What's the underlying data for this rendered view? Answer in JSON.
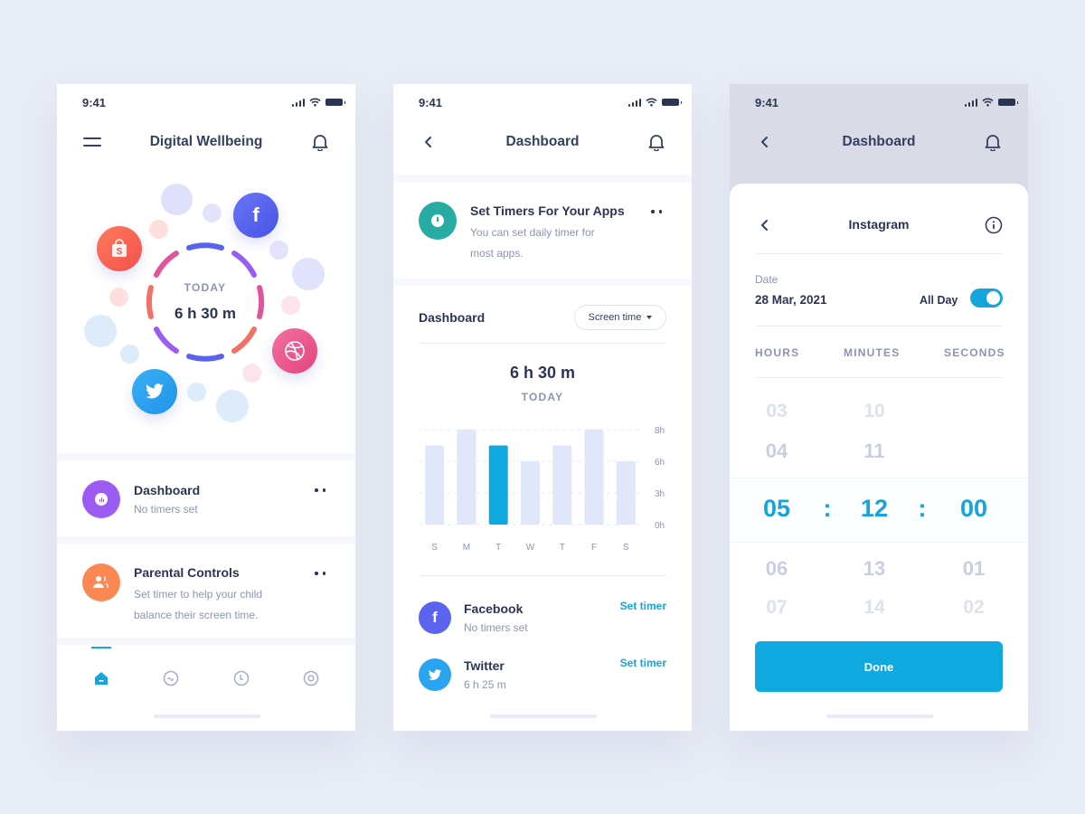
{
  "status_bar": {
    "time": "9:41"
  },
  "screen1": {
    "title": "Digital Wellbeing",
    "ring": {
      "label": "TODAY",
      "value": "6 h 30 m"
    },
    "apps_icons": [
      "shopee-bag-icon",
      "facebook-icon",
      "dribbble-icon",
      "twitter-icon"
    ],
    "cards": [
      {
        "title": "Dashboard",
        "subtitle": "No timers set",
        "icon": "chart-icon",
        "color": "#9c5cf3"
      },
      {
        "title": "Parental Controls",
        "subtitle_line1": "Set timer to help your child",
        "subtitle_line2": "balance their screen time.",
        "icon": "users-icon",
        "color": "#fb8852"
      }
    ],
    "tabs": [
      {
        "name": "home",
        "active": true
      },
      {
        "name": "activity",
        "active": false
      },
      {
        "name": "timer",
        "active": false
      },
      {
        "name": "settings",
        "active": false
      }
    ]
  },
  "screen2": {
    "title": "Dashboard",
    "promo": {
      "title": "Set Timers For Your Apps",
      "line1": "You can set daily timer for",
      "line2": "most apps."
    },
    "dashboard_label": "Dashboard",
    "dropdown": {
      "value": "Screen time"
    },
    "total": "6 h 30 m",
    "total_label": "TODAY",
    "apps": [
      {
        "name": "Facebook",
        "detail": "No timers set",
        "action": "Set timer",
        "color": "#5b63ef"
      },
      {
        "name": "Twitter",
        "detail": "6 h 25 m",
        "action": "Set timer",
        "color": "#2aa3f0"
      }
    ]
  },
  "chart_data": {
    "type": "bar",
    "title": "",
    "categories": [
      "S",
      "M",
      "T",
      "W",
      "T",
      "F",
      "S"
    ],
    "values": [
      7,
      8,
      7,
      6,
      7,
      8,
      6
    ],
    "highlight_index": 2,
    "yticks": [
      "0h",
      "3h",
      "6h",
      "8h"
    ],
    "ylim": [
      0,
      8
    ],
    "xlabel": "",
    "ylabel": "",
    "grid": true,
    "colors": {
      "bar": "#e1e7fb",
      "highlight": "#0fa8df"
    }
  },
  "screen3": {
    "title": "Dashboard",
    "sheet_title": "Instagram",
    "date_label": "Date",
    "date_value": "28 Mar, 2021",
    "all_day_label": "All Day",
    "all_day_on": true,
    "columns": [
      "HOURS",
      "MINUTES",
      "SECONDS"
    ],
    "hours": {
      "above2": "03",
      "above1": "04",
      "selected": "05",
      "below1": "06",
      "below2": "07"
    },
    "minutes": {
      "above2": "10",
      "above1": "11",
      "selected": "12",
      "below1": "13",
      "below2": "14"
    },
    "seconds": {
      "above2": "",
      "above1": "",
      "selected": "00",
      "below1": "01",
      "below2": "02"
    },
    "separator": ":",
    "done_label": "Done",
    "accent": "#0fa8df"
  }
}
